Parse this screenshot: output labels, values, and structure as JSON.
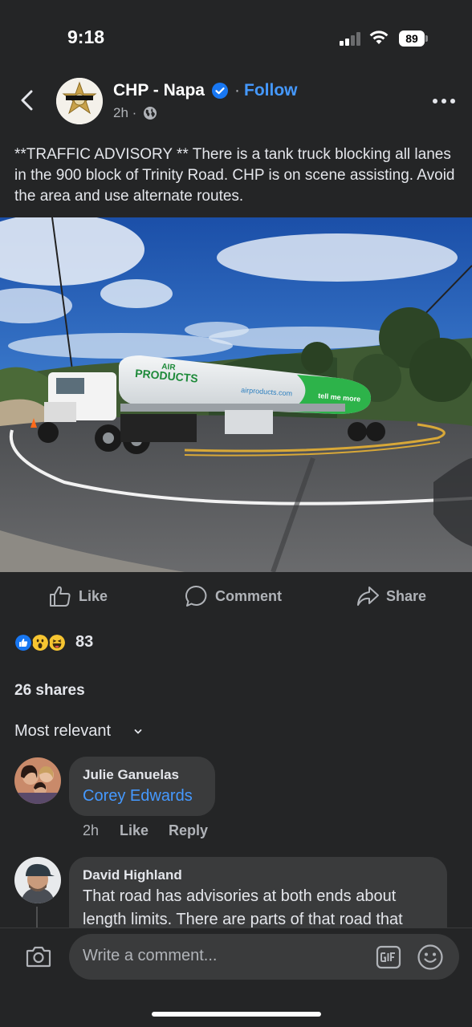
{
  "status_bar": {
    "time": "9:18",
    "battery": "89"
  },
  "post": {
    "page_name": "CHP - Napa",
    "follow_label": "Follow",
    "follow_separator": "·",
    "time": "2h ·",
    "text": "**TRAFFIC ADVISORY ** There is a tank truck blocking all lanes in the 900 block of Trinity Road.  CHP is on scene assisting. Avoid the area and use alternate routes.",
    "photo": {
      "truck_brand_line1": "AIR",
      "truck_brand_line2": "PRODUCTS",
      "truck_url": "airproducts.com",
      "truck_tagline": "tell me more"
    }
  },
  "actions": {
    "like": "Like",
    "comment": "Comment",
    "share": "Share"
  },
  "reactions": {
    "icons": [
      "like-reaction",
      "wow-reaction",
      "haha-reaction"
    ],
    "count": "83"
  },
  "shares": "26 shares",
  "sort_label": "Most relevant",
  "comments": [
    {
      "author": "Julie Ganuelas",
      "mention": "Corey Edwards",
      "time": "2h",
      "like": "Like",
      "reply": "Reply"
    },
    {
      "author": "David Highland",
      "text_line1": "That road has advisories at both ends about",
      "text_line2": "length limits. There are parts of that road that"
    }
  ],
  "composer": {
    "placeholder": "Write a comment..."
  },
  "colors": {
    "background": "#242526",
    "bubble": "#3a3b3c",
    "link": "#4599ff",
    "verified": "#1877f2",
    "brand_green": "#2db34a"
  }
}
